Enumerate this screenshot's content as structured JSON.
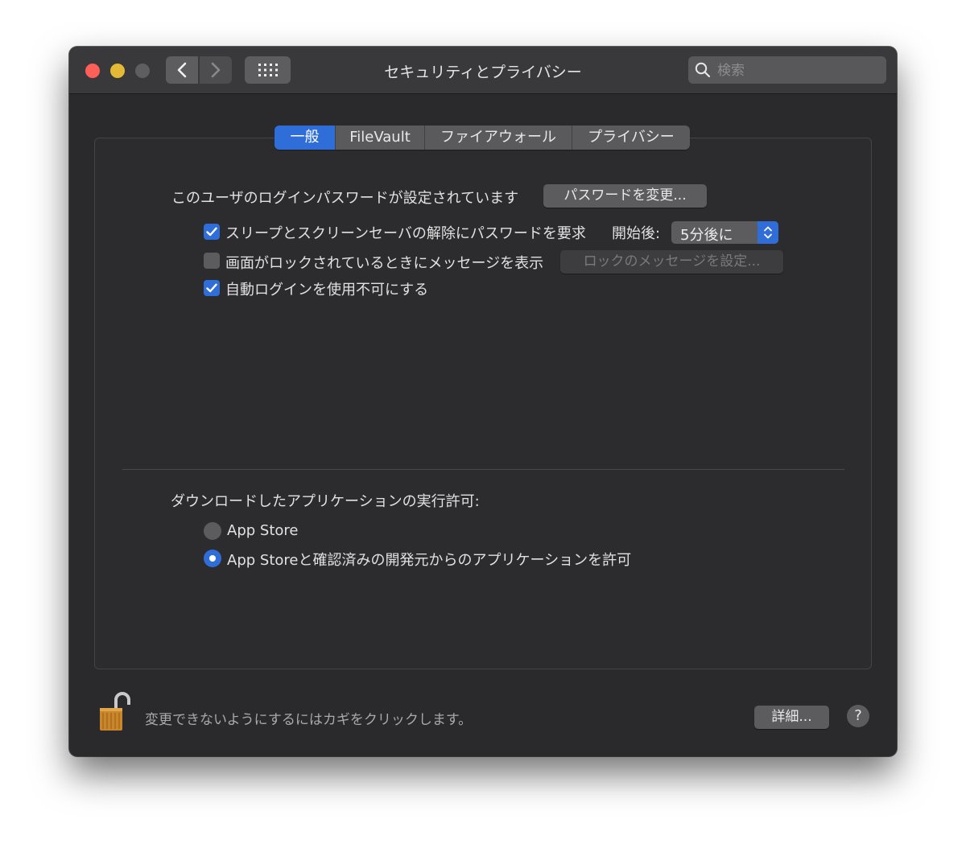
{
  "window": {
    "title": "セキュリティとプライバシー",
    "search_placeholder": "検索"
  },
  "tabs": [
    {
      "label": "一般",
      "active": true
    },
    {
      "label": "FileVault",
      "active": false
    },
    {
      "label": "ファイアウォール",
      "active": false
    },
    {
      "label": "プライバシー",
      "active": false
    }
  ],
  "general": {
    "password_status": "このユーザのログインパスワードが設定されています",
    "change_password_button": "パスワードを変更...",
    "require_password": {
      "label": "スリープとスクリーンセーバの解除にパスワードを要求",
      "checked": true
    },
    "delay_label": "開始後:",
    "delay_value": "5分後に",
    "show_message": {
      "label": "画面がロックされているときにメッセージを表示",
      "checked": false
    },
    "set_message_button": "ロックのメッセージを設定...",
    "disable_auto_login": {
      "label": "自動ログインを使用不可にする",
      "checked": true
    },
    "download_heading": "ダウンロードしたアプリケーションの実行許可:",
    "download_options": [
      {
        "label": "App Store",
        "selected": false
      },
      {
        "label": "App Storeと確認済みの開発元からのアプリケーションを許可",
        "selected": true
      }
    ]
  },
  "footer": {
    "lock_text": "変更できないようにするにはカギをクリックします。",
    "advanced_button": "詳細...",
    "help_label": "?"
  },
  "colors": {
    "accent": "#2f6ed8",
    "window_bg": "#2a2a2c",
    "titlebar_bg": "#39393b",
    "close": "#fe5f57",
    "minimize": "#e3b935"
  }
}
